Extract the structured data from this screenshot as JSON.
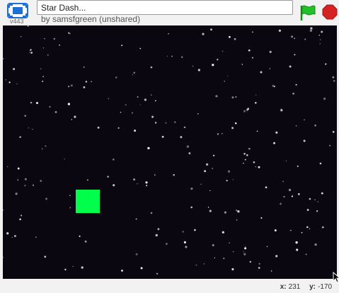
{
  "header": {
    "version": "v443",
    "title_value": "Star Dash...",
    "byline": "by samsfgreen (unshared)"
  },
  "controls": {
    "fullscreen_icon": "fullscreen-icon",
    "flag_icon": "green-flag-icon",
    "stop_icon": "stop-sign-icon",
    "flag_color": "#22c02a",
    "stop_color": "#d52323"
  },
  "stage": {
    "background_color": "#0b0711",
    "sprite_color": "#00ff4a"
  },
  "status": {
    "x_label": "x:",
    "x_value": "231",
    "y_label": "y:",
    "y_value": "-170"
  }
}
